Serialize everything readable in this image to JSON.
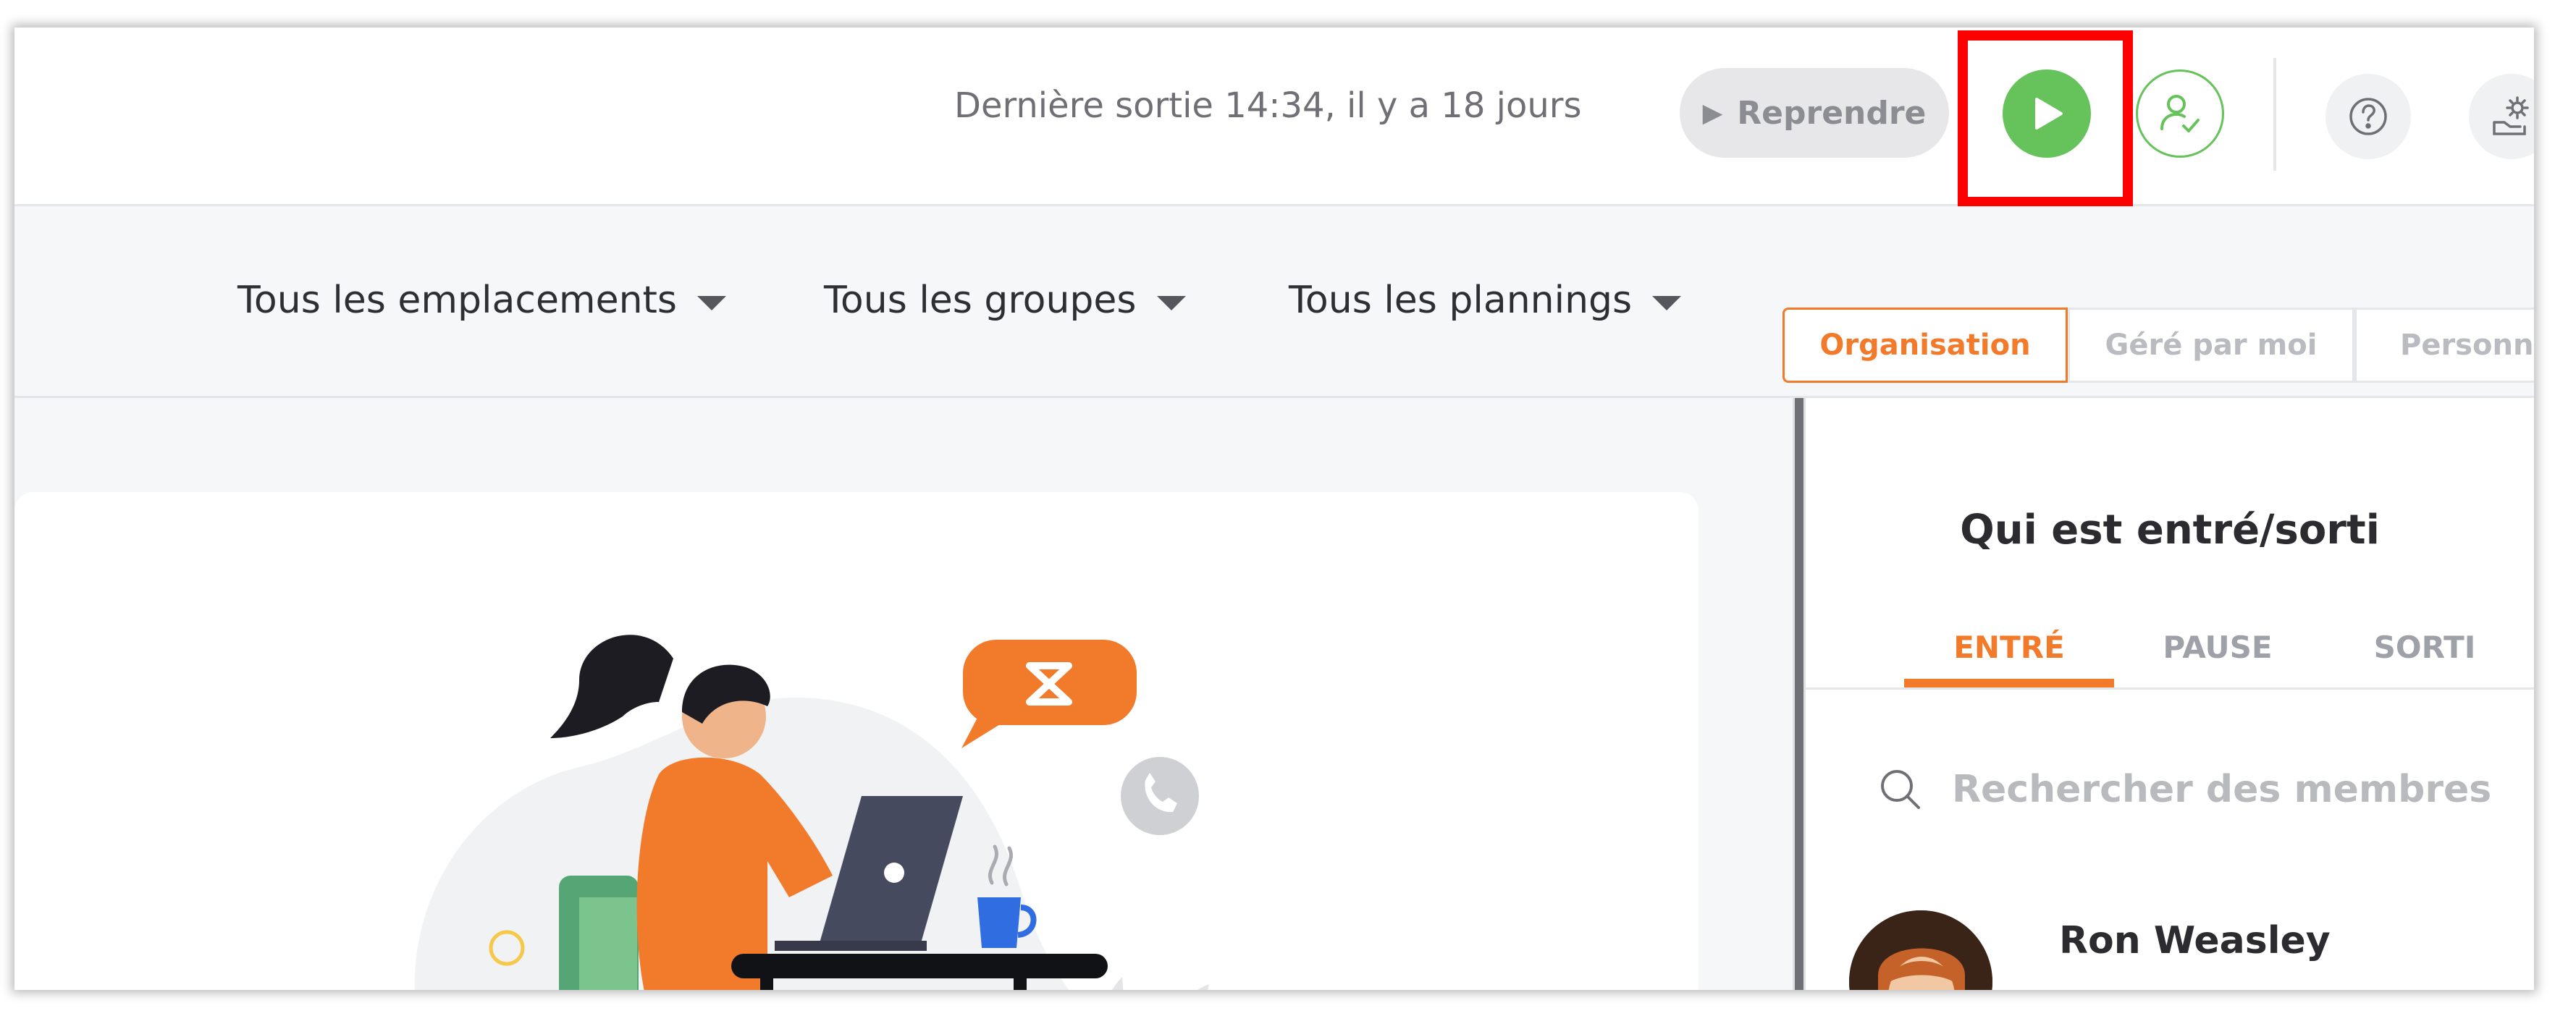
{
  "header": {
    "last_out_text": "Dernière sortie 14:34, il y a 18 jours",
    "resume_label": "Reprendre",
    "icons": [
      "play-icon",
      "person-check-icon",
      "help-icon",
      "settings-icon"
    ]
  },
  "filters": {
    "locations": "Tous les emplacements",
    "groups": "Tous les groupes",
    "schedules": "Tous les plannings"
  },
  "scope_tabs": [
    "Organisation",
    "Géré par moi",
    "Personnel"
  ],
  "who_panel": {
    "title": "Qui est entré/sorti",
    "tabs": [
      "ENTRÉ",
      "PAUSE",
      "SORTI"
    ],
    "active_tab": "ENTRÉ",
    "search_placeholder": "Rechercher des membres",
    "members": [
      {
        "name": "Ron Weasley"
      }
    ]
  },
  "colors": {
    "accent": "#f27a2b",
    "play_green": "#66c25b",
    "highlight_red": "#ff0000"
  }
}
